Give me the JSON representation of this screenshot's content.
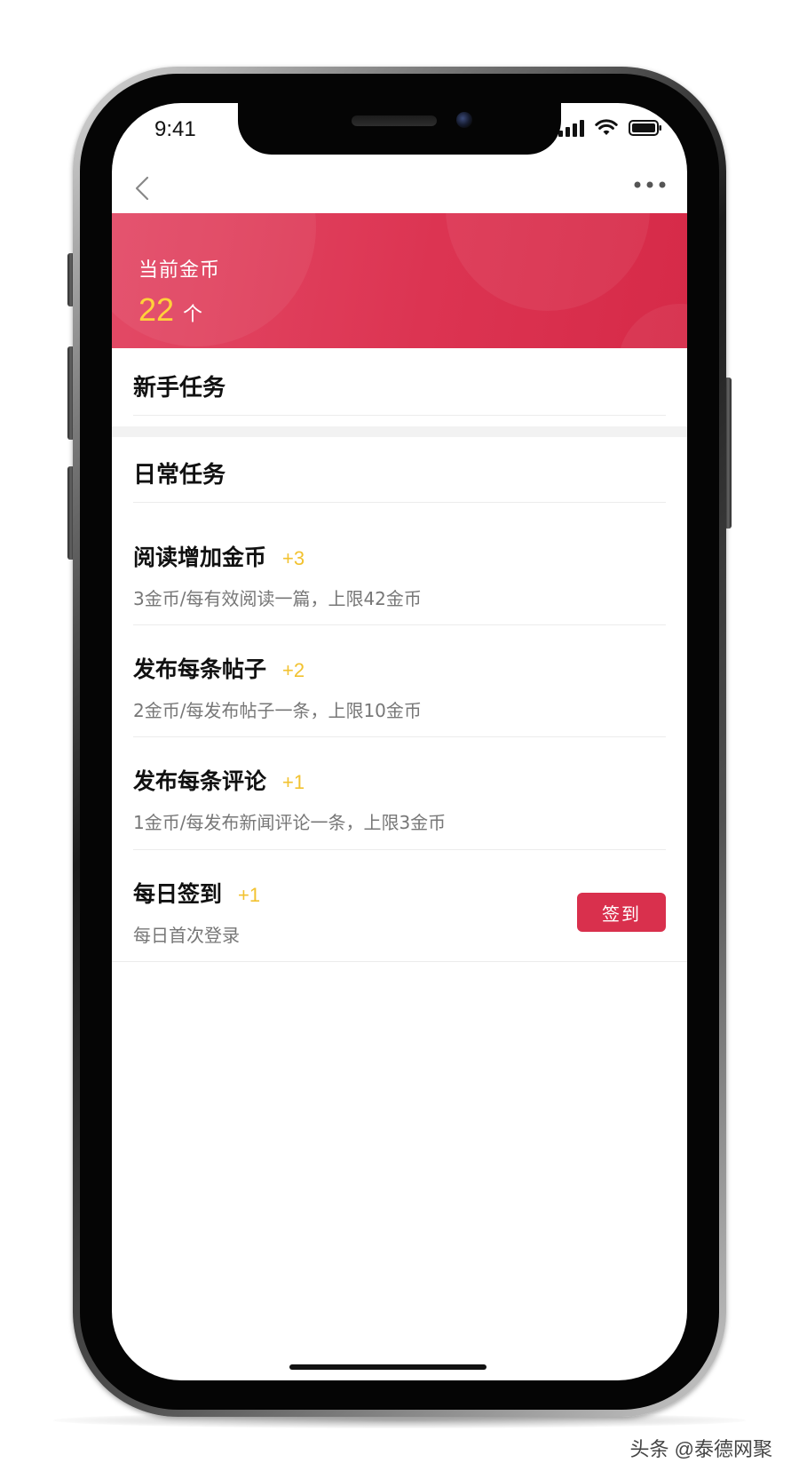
{
  "status_bar": {
    "time": "9:41"
  },
  "nav": {
    "back_icon": "chevron-left-icon",
    "more_icon": "more-dots-icon"
  },
  "banner": {
    "label": "当前金币",
    "amount": "22",
    "unit": "个",
    "colors": {
      "background": "#dc3452",
      "amount": "#ffd23a"
    }
  },
  "sections": {
    "newbie_title": "新手任务",
    "daily_title": "日常任务"
  },
  "tasks": [
    {
      "name": "阅读增加金币",
      "reward": "+3",
      "desc": "3金币/每有效阅读一篇，上限42金币"
    },
    {
      "name": "发布每条帖子",
      "reward": "+2",
      "desc": "2金币/每发布帖子一条，上限10金币"
    },
    {
      "name": "发布每条评论",
      "reward": "+1",
      "desc": "1金币/每发布新闻评论一条，上限3金币"
    },
    {
      "name": "每日签到",
      "reward": "+1",
      "desc": "每日首次登录",
      "button": "签到"
    }
  ],
  "watermark": "头条 @泰德网聚",
  "colors": {
    "accent": "#d9304d",
    "reward": "#f2c230"
  }
}
